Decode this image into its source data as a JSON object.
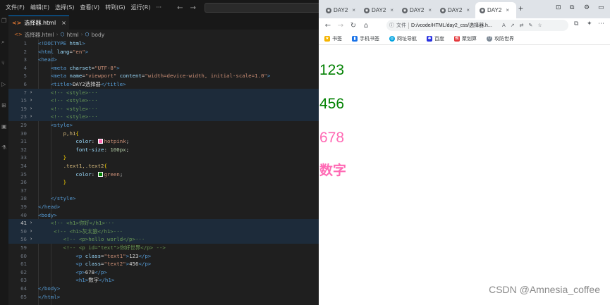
{
  "vscode": {
    "menu": [
      "文件(F)",
      "编辑(E)",
      "选择(S)",
      "查看(V)",
      "转到(G)",
      "运行(R)",
      "···"
    ],
    "tab": {
      "label": "选择器.html",
      "close": "×"
    },
    "breadcrumb": [
      "选择器.html",
      "html",
      "body"
    ],
    "lines": [
      {
        "n": "1",
        "fold": "",
        "hl": false,
        "html": "<span class='t-tag'>&lt;!DOCTYPE</span> <span class='t-attr'>html</span><span class='t-tag'>&gt;</span>"
      },
      {
        "n": "2",
        "fold": "",
        "hl": false,
        "html": "<span class='t-tag'>&lt;html</span> <span class='t-attr'>lang</span>=<span class='t-str'>\"en\"</span><span class='t-tag'>&gt;</span>"
      },
      {
        "n": "3",
        "fold": "",
        "hl": false,
        "html": "<span class='t-tag'>&lt;head&gt;</span>"
      },
      {
        "n": "4",
        "fold": "",
        "hl": false,
        "html": "    <span class='t-tag'>&lt;meta</span> <span class='t-attr'>charset</span>=<span class='t-str'>\"UTF-8\"</span><span class='t-tag'>&gt;</span>"
      },
      {
        "n": "5",
        "fold": "",
        "hl": false,
        "html": "    <span class='t-tag'>&lt;meta</span> <span class='t-attr'>name</span>=<span class='t-str'>\"viewport\"</span> <span class='t-attr'>content</span>=<span class='t-str'>\"width=device-width, initial-scale=1.0\"</span><span class='t-tag'>&gt;</span>"
      },
      {
        "n": "6",
        "fold": "",
        "hl": false,
        "html": "    <span class='t-tag'>&lt;title&gt;</span><span class='t-txt'>DAY2选择器</span><span class='t-tag'>&lt;/title&gt;</span>"
      },
      {
        "n": "7",
        "fold": "›",
        "hl": true,
        "html": "    <span class='t-com'>&lt;!-- &lt;style&gt;···</span>"
      },
      {
        "n": "15",
        "fold": "›",
        "hl": true,
        "html": "    <span class='t-com'>&lt;!-- &lt;style&gt;···</span>"
      },
      {
        "n": "19",
        "fold": "›",
        "hl": true,
        "html": "    <span class='t-com'>&lt;!-- &lt;style&gt;···</span>"
      },
      {
        "n": "23",
        "fold": "›",
        "hl": true,
        "html": "    <span class='t-com'>&lt;!-- &lt;style&gt;···</span>"
      },
      {
        "n": "29",
        "fold": "",
        "hl": false,
        "html": "    <span class='t-tag'>&lt;style&gt;</span>"
      },
      {
        "n": "30",
        "fold": "",
        "hl": false,
        "html": "        <span class='t-sel'>p,h1</span><span class='t-br'>{</span>"
      },
      {
        "n": "31",
        "fold": "",
        "hl": false,
        "html": "            <span class='t-prop'>color</span>: <span class='swatch' style='background:#ff69b4'></span><span class='t-val'>hotpink</span>;"
      },
      {
        "n": "32",
        "fold": "",
        "hl": false,
        "html": "            <span class='t-prop'>font-size</span>: <span class='t-num'>100px</span>;"
      },
      {
        "n": "33",
        "fold": "",
        "hl": false,
        "html": "        <span class='t-br'>}</span>"
      },
      {
        "n": "34",
        "fold": "",
        "hl": false,
        "html": "        <span class='t-sel'>.text1,.text2</span><span class='t-br'>{</span>"
      },
      {
        "n": "35",
        "fold": "",
        "hl": false,
        "html": "            <span class='t-prop'>color</span>: <span class='swatch' style='background:#008000'></span><span class='t-val'>green</span>;"
      },
      {
        "n": "36",
        "fold": "",
        "hl": false,
        "html": "        <span class='t-br'>}</span>"
      },
      {
        "n": "37",
        "fold": "",
        "hl": false,
        "html": ""
      },
      {
        "n": "38",
        "fold": "",
        "hl": false,
        "html": "    <span class='t-tag'>&lt;/style&gt;</span>"
      },
      {
        "n": "39",
        "fold": "",
        "hl": false,
        "html": "<span class='t-tag'>&lt;/head&gt;</span>"
      },
      {
        "n": "40",
        "fold": "",
        "hl": false,
        "html": "<span class='t-tag'>&lt;body&gt;</span>"
      },
      {
        "n": "41",
        "fold": "›",
        "hl": true,
        "active": true,
        "html": "    <span class='t-com'>&lt;!-- &lt;h1&gt;你好&lt;/h1&gt;···</span>"
      },
      {
        "n": "50",
        "fold": "›",
        "hl": true,
        "html": "     <span class='t-com'>&lt;!-- &lt;h1&gt;灰太狼&lt;/h1&gt;···</span>"
      },
      {
        "n": "56",
        "fold": "›",
        "hl": true,
        "html": "        <span class='t-com'>&lt;!-- &lt;p&gt;hello world&lt;/p&gt;···</span>"
      },
      {
        "n": "59",
        "fold": "",
        "hl": false,
        "html": "        <span class='t-com'>&lt;!-- &lt;p id=\"text\"&gt;你好世界&lt;/p&gt; --&gt;</span>"
      },
      {
        "n": "60",
        "fold": "",
        "hl": false,
        "html": "            <span class='t-tag'>&lt;p</span> <span class='t-attr'>class</span>=<span class='t-str'>\"text1\"</span><span class='t-tag'>&gt;</span><span class='t-txt'>123</span><span class='t-tag'>&lt;/p&gt;</span>"
      },
      {
        "n": "61",
        "fold": "",
        "hl": false,
        "html": "            <span class='t-tag'>&lt;p</span> <span class='t-attr'>class</span>=<span class='t-str'>\"text2\"</span><span class='t-tag'>&gt;</span><span class='t-txt'>456</span><span class='t-tag'>&lt;/p&gt;</span>"
      },
      {
        "n": "62",
        "fold": "",
        "hl": false,
        "html": "            <span class='t-tag'>&lt;p&gt;</span><span class='t-txt'>678</span><span class='t-tag'>&lt;/p&gt;</span>"
      },
      {
        "n": "63",
        "fold": "",
        "hl": false,
        "html": "            <span class='t-tag'>&lt;h1&gt;</span><span class='t-txt'>数字</span><span class='t-tag'>&lt;/h1&gt;</span>"
      },
      {
        "n": "64",
        "fold": "",
        "hl": false,
        "html": "<span class='t-tag'>&lt;/body&gt;</span>"
      },
      {
        "n": "65",
        "fold": "",
        "hl": false,
        "html": "<span class='t-tag'>&lt;/html&gt;</span>"
      }
    ]
  },
  "browser": {
    "tabs": [
      "DAY2",
      "DAY2",
      "DAY2",
      "DAY2",
      "DAY2"
    ],
    "new_tab": "+",
    "address": {
      "scheme": "文件",
      "url": "D:/vcode/HTML/day2_css/选择器.h..."
    },
    "bookmarks": [
      "书签",
      "手机书签",
      "网址导航",
      "百度",
      "聚划算",
      "攻防世界"
    ],
    "output": {
      "p1": "123",
      "p2": "456",
      "p3": "678",
      "h1": "数字"
    }
  },
  "watermark": "CSDN @Amnesia_coffee",
  "colors": {
    "green": "#008000",
    "hotpink": "#ff69b4",
    "vscode_bg": "#1f1f1f",
    "accent": "#0078d4"
  }
}
